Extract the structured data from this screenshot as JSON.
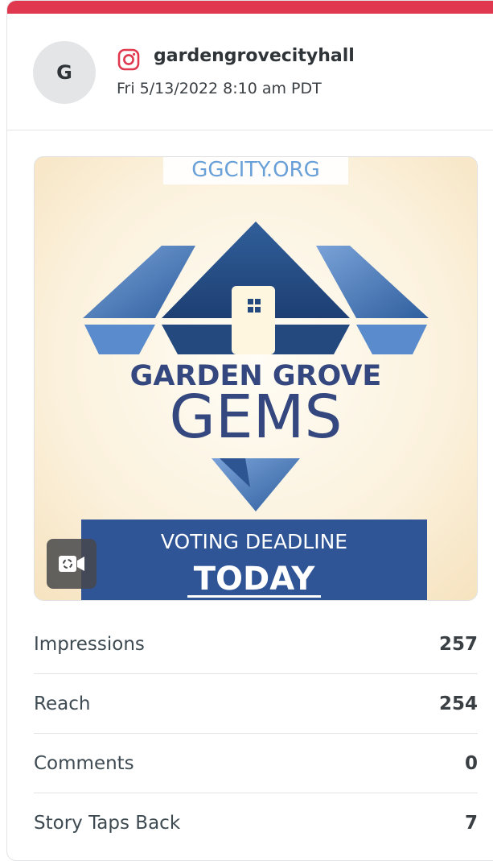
{
  "post": {
    "platform_icon": "instagram-icon",
    "avatar_initial": "G",
    "username": "gardengrovecityhall",
    "timestamp": "Fri 5/13/2022 8:10 am PDT",
    "accent_color": "#e0394f"
  },
  "media": {
    "type_icon": "video-icon",
    "image_text": {
      "url_partial": "GGCITY.ORG",
      "line1": "GARDEN GROVE",
      "line2": "GEMS",
      "banner_line1": "VOTING DEADLINE",
      "banner_line2": "TODAY"
    }
  },
  "stats": [
    {
      "label": "Impressions",
      "value": "257"
    },
    {
      "label": "Reach",
      "value": "254"
    },
    {
      "label": "Comments",
      "value": "0"
    },
    {
      "label": "Story Taps Back",
      "value": "7"
    }
  ]
}
